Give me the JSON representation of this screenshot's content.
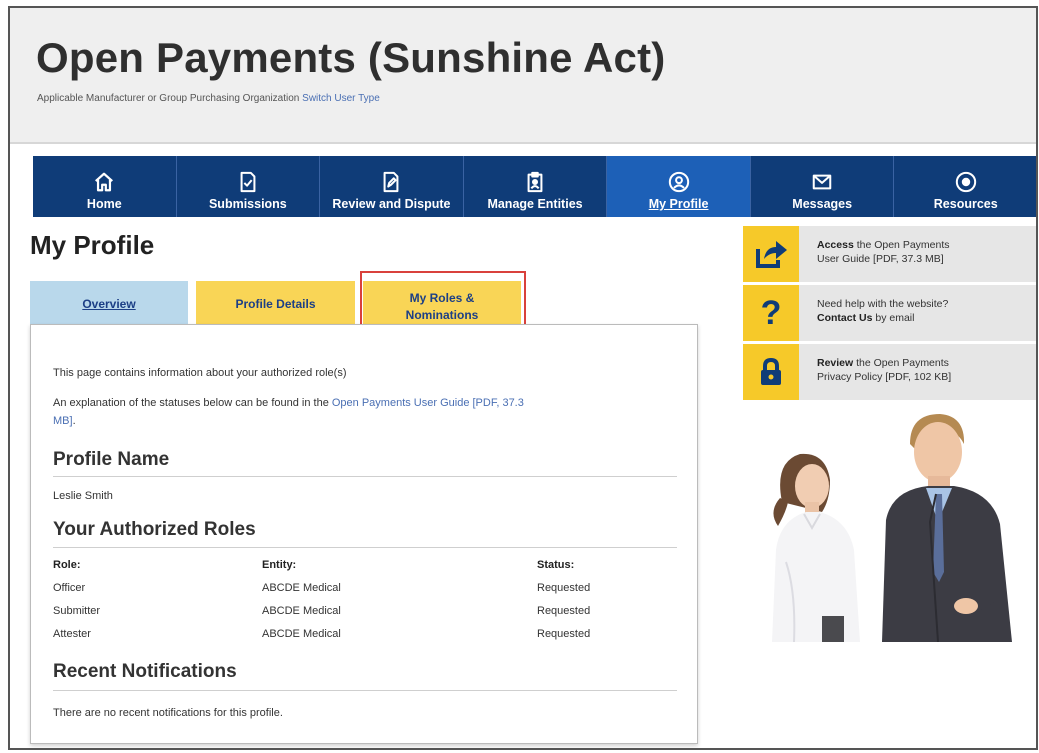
{
  "header": {
    "site_title": "Open Payments (Sunshine Act)",
    "user_type_prefix": "Applicable Manufacturer or Group Purchasing Organization",
    "switch_user_type": "Switch User Type"
  },
  "nav": {
    "items": [
      {
        "label": "Home",
        "icon": "home-icon"
      },
      {
        "label": "Submissions",
        "icon": "document-check-icon"
      },
      {
        "label": "Review and Dispute",
        "icon": "document-edit-icon"
      },
      {
        "label": "Manage Entities",
        "icon": "clipboard-icon"
      },
      {
        "label": "My Profile",
        "icon": "user-circle-icon",
        "active": true
      },
      {
        "label": "Messages",
        "icon": "envelope-icon"
      },
      {
        "label": "Resources",
        "icon": "gear-circle-icon"
      }
    ]
  },
  "page": {
    "title": "My Profile"
  },
  "tabs": {
    "overview": "Overview",
    "details": "Profile Details",
    "roles_line1": "My Roles &",
    "roles_line2": "Nominations"
  },
  "panel": {
    "intro": "This page contains information about your authorized role(s)",
    "explain_prefix": "An explanation of the statuses below can be found in the",
    "explain_link_line1": "Open Payments User Guide [PDF, 37.3",
    "explain_link_line2": "MB]",
    "explain_suffix": ".",
    "profile_name_heading": "Profile Name",
    "profile_name": "Leslie Smith",
    "roles_heading": "Your Authorized Roles",
    "col_role": "Role:",
    "col_entity": "Entity:",
    "col_status": "Status:",
    "rows": [
      {
        "role": "Officer",
        "entity": "ABCDE Medical",
        "status": "Requested"
      },
      {
        "role": "Submitter",
        "entity": "ABCDE Medical",
        "status": "Requested"
      },
      {
        "role": "Attester",
        "entity": "ABCDE Medical",
        "status": "Requested"
      }
    ],
    "notifications_heading": "Recent Notifications",
    "notifications_text": "There are no recent notifications for this profile."
  },
  "sidebar": {
    "guide_bold": "Access",
    "guide_line1_rest": " the Open Payments",
    "guide_line2": "User Guide [PDF, 37.3 MB]",
    "help_line1": "Need help with the website?",
    "help_bold": "Contact Us",
    "help_line2_rest": " by email",
    "privacy_bold": "Review",
    "privacy_line1_rest": " the Open Payments",
    "privacy_line2": "Privacy Policy [PDF, 102 KB]"
  },
  "colors": {
    "nav_bg": "#0f3c78",
    "nav_active": "#1d60b7",
    "tab_blue": "#b9d8eb",
    "tab_yellow": "#f9d556",
    "icon_yellow": "#f6c929",
    "highlight": "#d9413c",
    "link": "#4a6fb3"
  }
}
